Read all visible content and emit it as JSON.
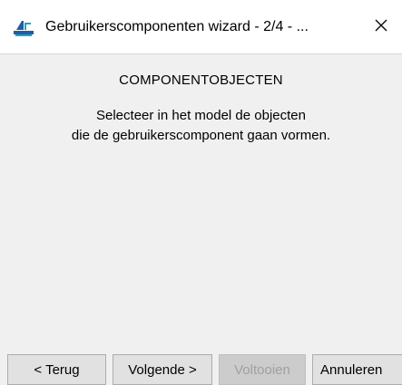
{
  "window": {
    "title": "Gebruikerscomponenten wizard - 2/4 - ...",
    "icon": "tekla-app-icon",
    "close_icon": "close-icon"
  },
  "content": {
    "heading": "COMPONENTOBJECTEN",
    "description_line1": "Selecteer in het model de objecten",
    "description_line2": "die de gebruikerscomponent gaan vormen."
  },
  "buttons": {
    "back": "< Terug",
    "next": "Volgende >",
    "finish": "Voltooien",
    "cancel": "Annuleren"
  },
  "colors": {
    "background": "#f0f0f0",
    "titlebar": "#ffffff",
    "icon_blue": "#1f5fa8",
    "icon_teal": "#2aa0b8",
    "disabled_text": "#a0a0a0"
  }
}
